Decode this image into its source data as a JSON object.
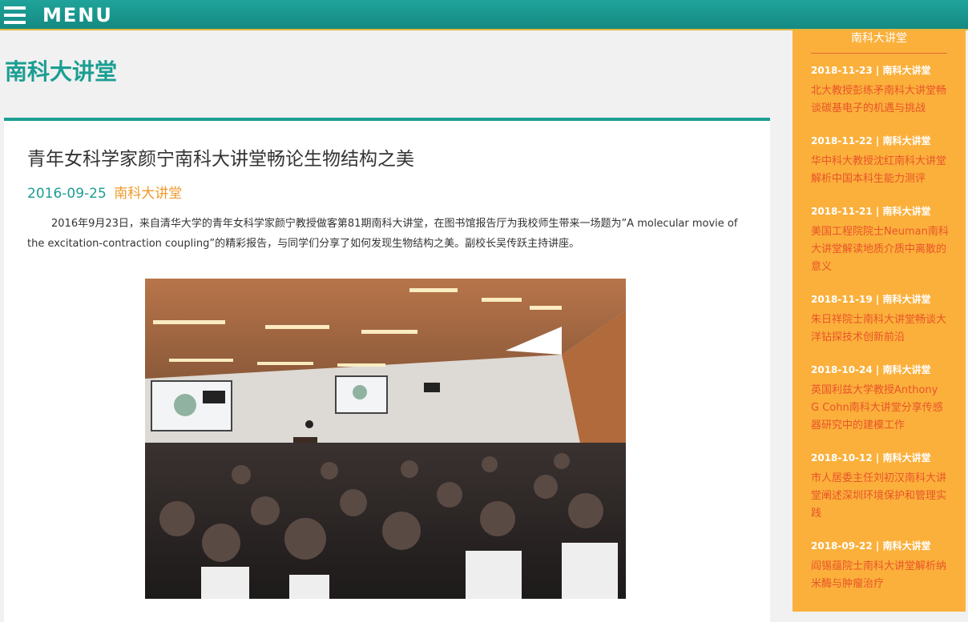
{
  "topbar": {
    "menu_label": "MENU",
    "accent": "#1c9e93",
    "border": "#e1b640"
  },
  "section_title": "南科大讲堂",
  "article": {
    "title": "青年女科学家颜宁南科大讲堂畅论生物结构之美",
    "date": "2016-09-25",
    "category": "南科大讲堂",
    "body": "2016年9月23日，来自清华大学的青年女科学家颜宁教授做客第81期南科大讲堂，在图书馆报告厅为我校师生带来一场题为”A molecular movie of the excitation-contraction coupling”的精彩报告，与同学们分享了如何发现生物结构之美。副校长吴传跃主持讲座。"
  },
  "sidebar": {
    "heading": "南科大讲堂",
    "background": "#fbb03b",
    "link_color": "#e8542a",
    "items": [
      {
        "meta": "2018-11-23 | 南科大讲堂",
        "title": "北大教授彭练矛南科大讲堂畅谈碳基电子的机遇与挑战"
      },
      {
        "meta": "2018-11-22 | 南科大讲堂",
        "title": "华中科大教授沈红南科大讲堂解析中国本科生能力测评"
      },
      {
        "meta": "2018-11-21 | 南科大讲堂",
        "title": "美国工程院院士Neuman南科大讲堂解读地质介质中离散的意义"
      },
      {
        "meta": "2018-11-19 | 南科大讲堂",
        "title": "朱日祥院士南科大讲堂畅谈大洋钻探技术创新前沿"
      },
      {
        "meta": "2018-10-24 | 南科大讲堂",
        "title": "英国利兹大学教授Anthony G Cohn南科大讲堂分享传感器研究中的建模工作"
      },
      {
        "meta": "2018-10-12 | 南科大讲堂",
        "title": "市人居委主任刘初汉南科大讲堂阐述深圳环境保护和管理实践"
      },
      {
        "meta": "2018-09-22 | 南科大讲堂",
        "title": "阎锡蕴院士南科大讲堂解析纳米酶与肿瘤治疗"
      }
    ]
  }
}
